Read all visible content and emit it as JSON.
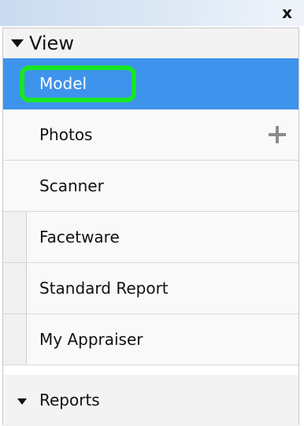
{
  "window": {
    "close_glyph": "x"
  },
  "view_section": {
    "label": "View"
  },
  "nav_items": [
    {
      "label": "Model",
      "selected": true
    },
    {
      "label": "Photos",
      "action_icon": "plus-icon"
    },
    {
      "label": "Scanner"
    },
    {
      "label": "Facetware"
    },
    {
      "label": "Standard Report"
    },
    {
      "label": "My Appraiser"
    }
  ],
  "reports_section": {
    "label": "Reports"
  },
  "colors": {
    "selected_bg": "#3e93ec",
    "highlight_ring": "#18e526",
    "title_bar": "#c9dbef"
  }
}
